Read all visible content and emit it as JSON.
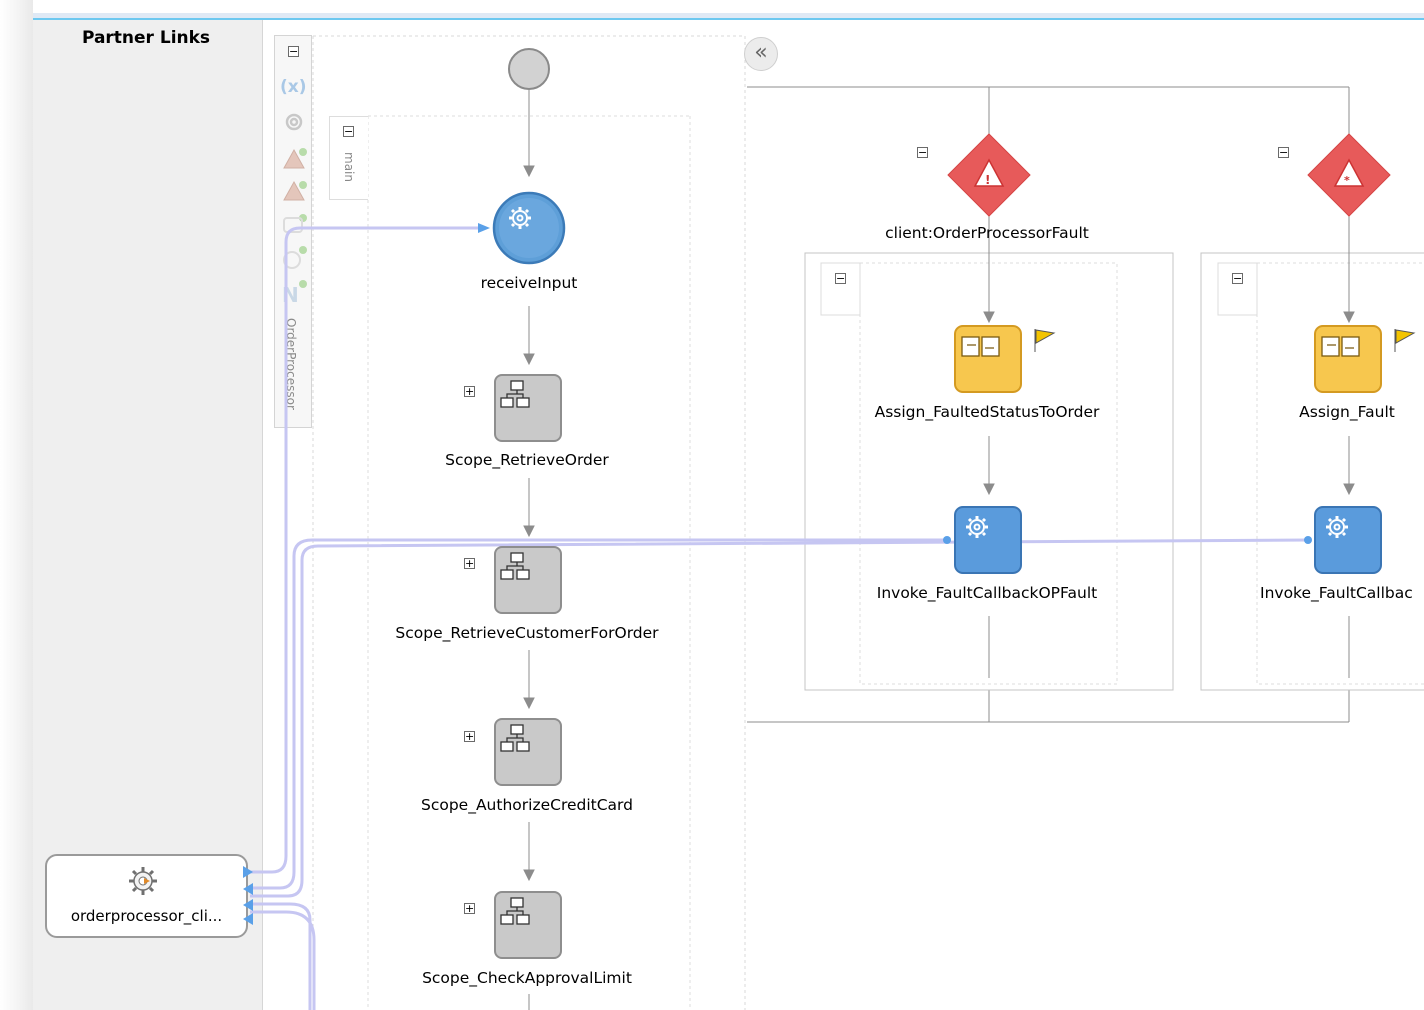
{
  "partner_links": {
    "title": "Partner Links",
    "node_label": "orderprocessor_cli..."
  },
  "process": {
    "name": "OrderProcessor",
    "scope_tab": "main",
    "activities": [
      {
        "label": "receiveInput",
        "icon": "receive-gear-icon"
      },
      {
        "label": "Scope_RetrieveOrder",
        "icon": "scope-icon"
      },
      {
        "label": "Scope_RetrieveCustomerForOrder",
        "icon": "scope-icon"
      },
      {
        "label": "Scope_AuthorizeCreditCard",
        "icon": "scope-icon"
      },
      {
        "label": "Scope_CheckApprovalLimit",
        "icon": "scope-icon"
      }
    ]
  },
  "fault_handlers": {
    "catch_1": {
      "label": "client:OrderProcessorFault",
      "assign": "Assign_FaultedStatusToOrder",
      "invoke": "Invoke_FaultCallbackOPFault"
    },
    "catch_2": {
      "assign": "Assign_Fault",
      "invoke": "Invoke_FaultCallbac"
    }
  },
  "colors": {
    "link_line": "#c6c6f2",
    "fault_diamond": "#e75a5a",
    "assign_fill": "#f7c74e",
    "invoke_fill": "#5a9bdc",
    "scope_fill": "#c8c8c8"
  }
}
